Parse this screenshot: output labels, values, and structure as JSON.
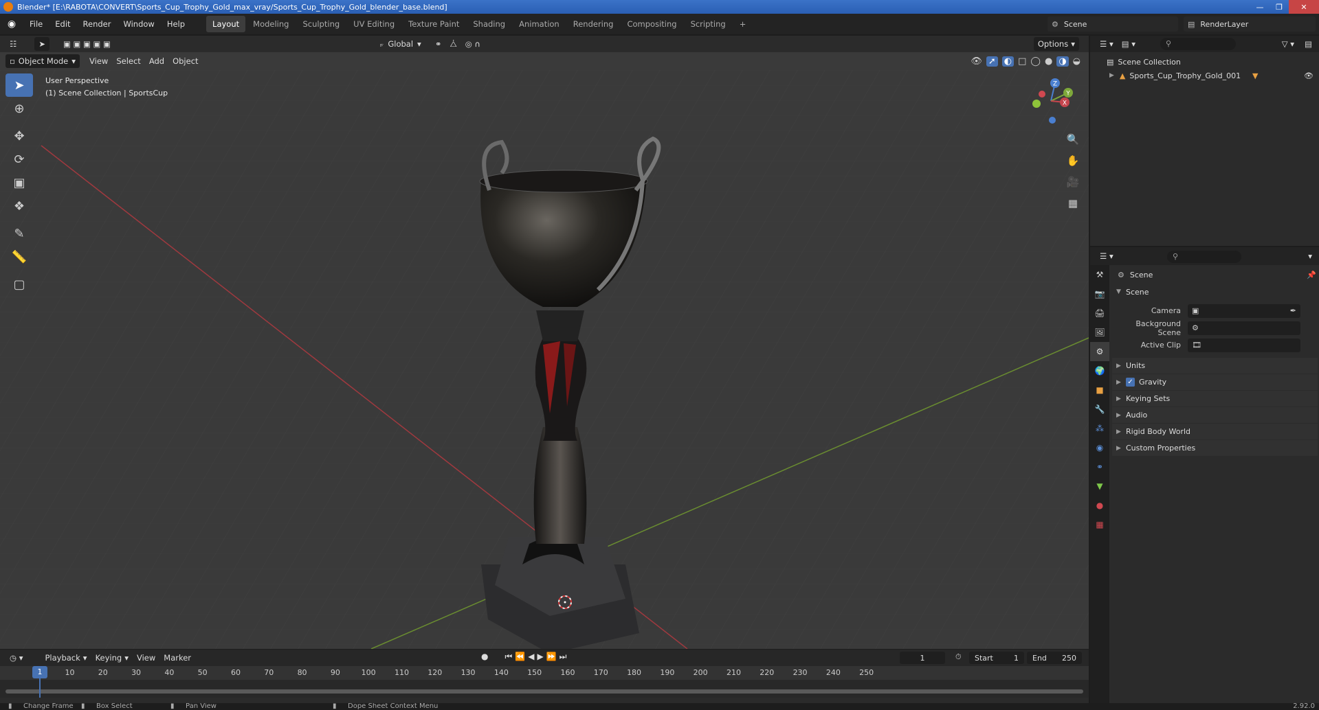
{
  "window": {
    "title": "Blender* [E:\\RABOTA\\CONVERT\\Sports_Cup_Trophy_Gold_max_vray/Sports_Cup_Trophy_Gold_blender_base.blend]"
  },
  "menu": [
    "File",
    "Edit",
    "Render",
    "Window",
    "Help"
  ],
  "workspaces": [
    "Layout",
    "Modeling",
    "Sculpting",
    "UV Editing",
    "Texture Paint",
    "Shading",
    "Animation",
    "Rendering",
    "Compositing",
    "Scripting"
  ],
  "active_workspace": "Layout",
  "scene_name": "Scene",
  "render_layer": "RenderLayer",
  "viewport": {
    "transform_orientation": "Global",
    "options_label": "Options",
    "mode": "Object Mode",
    "header_menus": [
      "View",
      "Select",
      "Add",
      "Object"
    ],
    "info_line1": "User Perspective",
    "info_line2": "(1) Scene Collection | SportsCup",
    "gizmo_axes": [
      "Z",
      "Y",
      "X"
    ]
  },
  "timeline": {
    "menus": [
      "Playback",
      "Keying",
      "View",
      "Marker"
    ],
    "current_frame": "1",
    "start_label": "Start",
    "start_value": "1",
    "end_label": "End",
    "end_value": "250",
    "ruler": [
      "1",
      "10",
      "20",
      "30",
      "40",
      "50",
      "60",
      "70",
      "80",
      "90",
      "100",
      "110",
      "120",
      "130",
      "140",
      "150",
      "160",
      "170",
      "180",
      "190",
      "200",
      "210",
      "220",
      "230",
      "240",
      "250"
    ]
  },
  "outliner": {
    "root": "Scene Collection",
    "items": [
      "Sports_Cup_Trophy_Gold_001"
    ]
  },
  "properties": {
    "breadcrumb": "Scene",
    "panel_title": "Scene",
    "fields": [
      {
        "label": "Camera"
      },
      {
        "label": "Background Scene"
      },
      {
        "label": "Active Clip"
      }
    ],
    "subpanels": [
      "Units",
      "Gravity",
      "Keying Sets",
      "Audio",
      "Rigid Body World",
      "Custom Properties"
    ],
    "gravity_checked": true
  },
  "statusbar": {
    "items": [
      "Change Frame",
      "Box Select",
      "Pan View",
      "Dope Sheet Context Menu"
    ],
    "version": "2.92.0"
  },
  "colors": {
    "accent": "#4772b3",
    "x_axis": "#c5454d",
    "y_axis": "#7ea83a",
    "z_axis": "#4a7fd0"
  }
}
